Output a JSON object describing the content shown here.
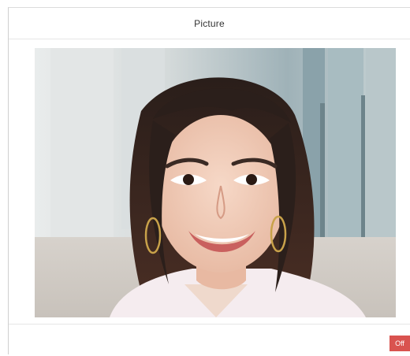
{
  "dialog": {
    "title": "Picture"
  },
  "image": {
    "content": "portrait-photo"
  },
  "footer": {
    "off_label": "Off"
  },
  "colors": {
    "off_button": "#d9534f",
    "header_text": "#333333",
    "divider": "#e6e6e6"
  }
}
